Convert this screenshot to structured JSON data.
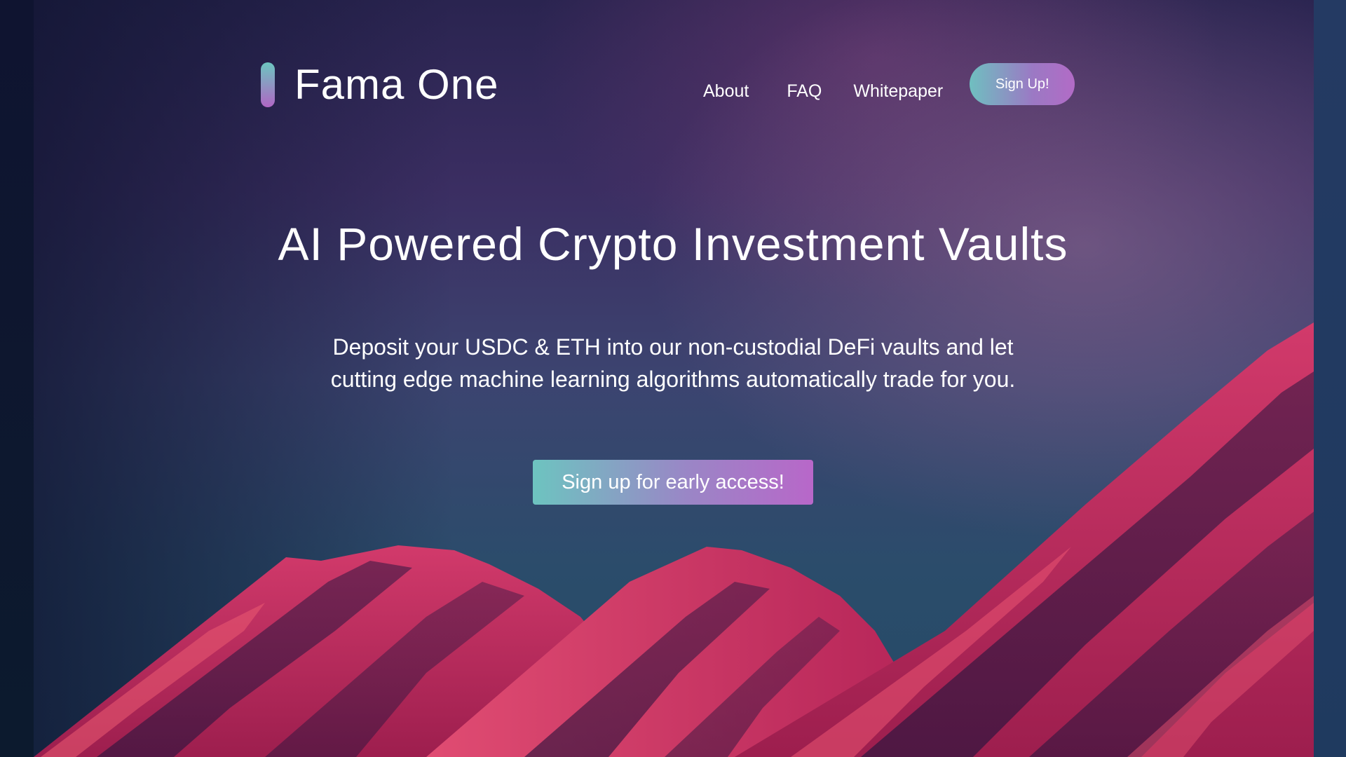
{
  "header": {
    "brand": "Fama One",
    "nav": {
      "about": "About",
      "faq": "FAQ",
      "whitepaper": "Whitepaper",
      "signup": "Sign Up!"
    }
  },
  "hero": {
    "headline": "AI Powered Crypto Investment Vaults",
    "subtext_line1": "Deposit your USDC & ETH into our non-custodial DeFi vaults and let",
    "subtext_line2": "cutting edge machine learning algorithms automatically trade for you.",
    "cta_label": "Sign up for early access!"
  },
  "colors": {
    "accent_start": "#6dc4c0",
    "accent_end": "#b867c9",
    "mountain": "#c02a5c"
  },
  "icons": {
    "logo_mark": "gradient-bar-icon"
  }
}
